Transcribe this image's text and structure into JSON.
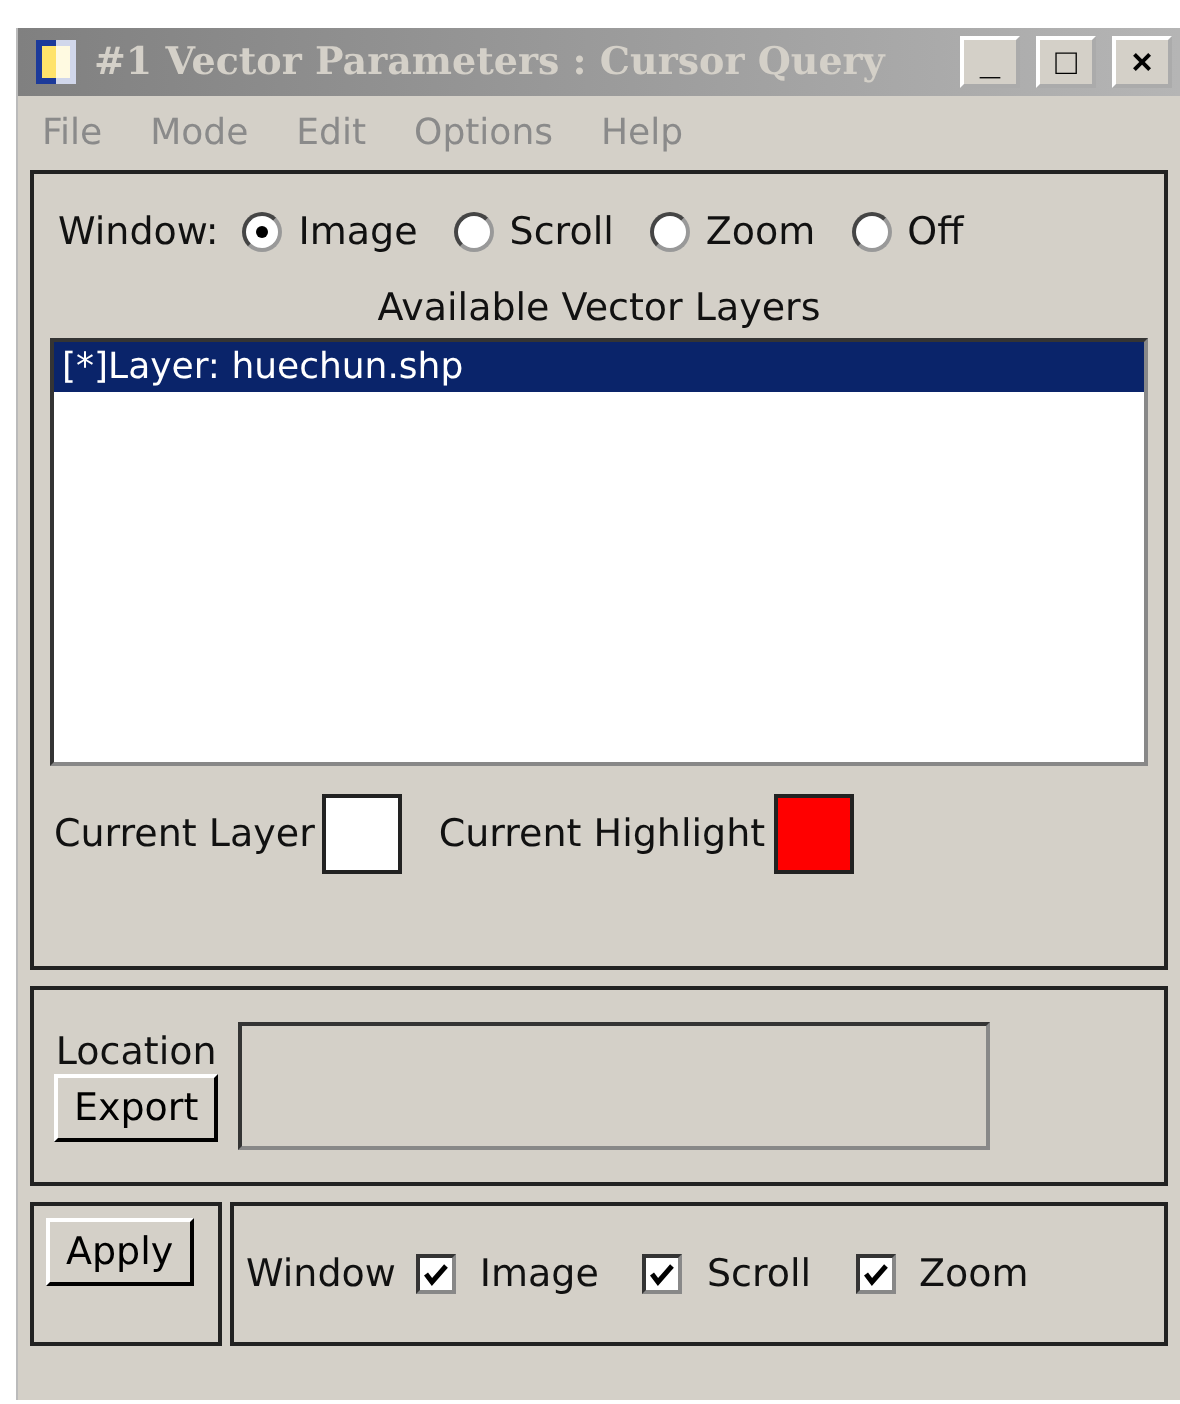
{
  "window": {
    "title": "#1 Vector Parameters : Cursor Query",
    "controls": [
      "_",
      "□",
      "×"
    ]
  },
  "menu": [
    "File",
    "Mode",
    "Edit",
    "Options",
    "Help"
  ],
  "window_choice": {
    "label": "Window:",
    "options": [
      {
        "label": "Image",
        "selected": true
      },
      {
        "label": "Scroll",
        "selected": false
      },
      {
        "label": "Zoom",
        "selected": false
      },
      {
        "label": "Off",
        "selected": false
      }
    ]
  },
  "layers": {
    "title": "Available Vector Layers",
    "items": [
      {
        "label": "[*]Layer: huechun.shp",
        "selected": true
      }
    ]
  },
  "swatches": [
    {
      "label": "Current Layer",
      "color": "#ffffff"
    },
    {
      "label": "Current Highlight",
      "color": "#ff0000"
    }
  ],
  "location": {
    "label": "Location",
    "button": "Export"
  },
  "apply": "Apply",
  "display": {
    "label": "Window",
    "options": [
      {
        "label": "Image",
        "checked": true
      },
      {
        "label": "Scroll",
        "checked": true
      },
      {
        "label": "Zoom",
        "checked": true
      }
    ]
  }
}
